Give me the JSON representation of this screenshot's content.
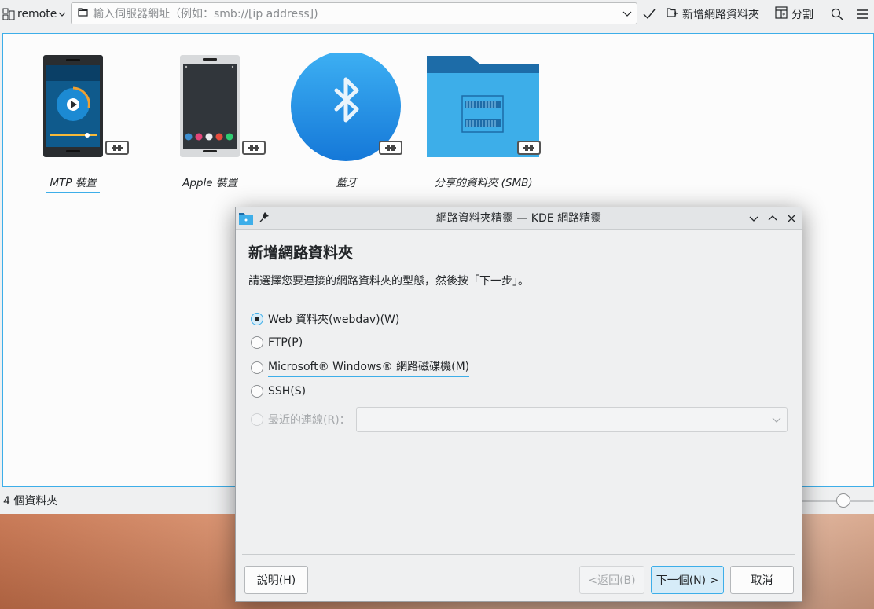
{
  "toolbar": {
    "places_label": "remote",
    "location_placeholder": "輸入伺服器網址（例如：smb://[ip address])",
    "new_network_folder": "新增網路資料夾",
    "split_label": "分割"
  },
  "files": [
    {
      "label": "MTP 裝置",
      "icon": "mtp-phone-icon"
    },
    {
      "label": "Apple 裝置",
      "icon": "apple-device-icon"
    },
    {
      "label": "藍牙",
      "icon": "bluetooth-icon"
    },
    {
      "label": "分享的資料夾 (SMB)",
      "icon": "smb-folder-icon"
    }
  ],
  "status": {
    "text": "4 個資料夾"
  },
  "dialog": {
    "title": "網路資料夾精靈 — KDE 網路精靈",
    "heading": "新增網路資料夾",
    "description": "請選擇您要連接的網路資料夾的型態，然後按「下一步」。",
    "options": [
      {
        "label": "Web 資料夾(webdav)(W)",
        "checked": true
      },
      {
        "label": "FTP(P)",
        "checked": false
      },
      {
        "label": "Microsoft® Windows® 網路磁碟機(M)",
        "checked": false
      },
      {
        "label": "SSH(S)",
        "checked": false
      },
      {
        "label": "最近的連線(R)：",
        "checked": false,
        "disabled": true
      }
    ],
    "buttons": {
      "help": "說明(H)",
      "back": "<返回(B)",
      "next": "下一個(N) >",
      "cancel": "取消"
    }
  },
  "colors": {
    "accent": "#3daee9",
    "window_bg": "#eff0f1",
    "view_bg": "#fcfcfc"
  }
}
